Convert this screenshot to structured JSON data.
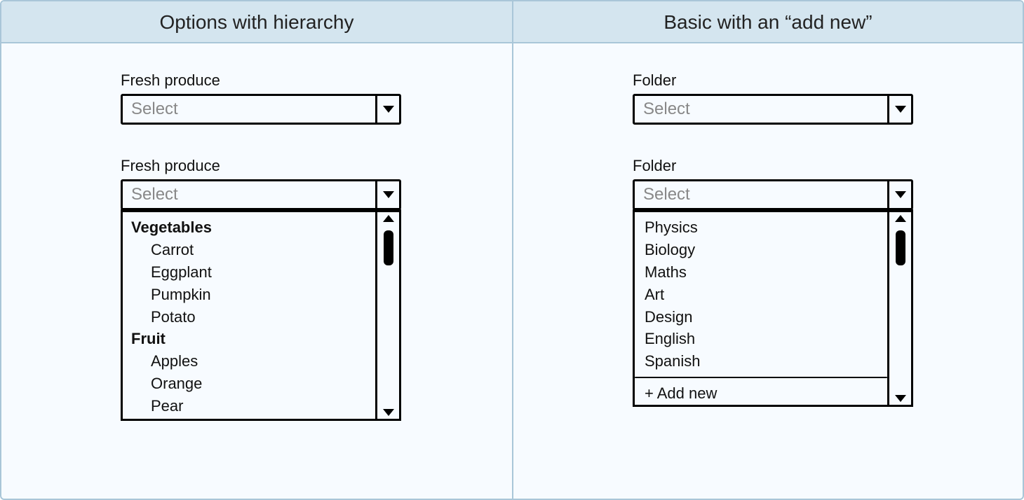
{
  "left": {
    "title": "Options with hierarchy",
    "field_label": "Fresh produce",
    "placeholder": "Select",
    "groups": [
      {
        "name": "Vegetables",
        "items": [
          "Carrot",
          "Eggplant",
          "Pumpkin",
          "Potato"
        ]
      },
      {
        "name": "Fruit",
        "items": [
          "Apples",
          "Orange",
          "Pear"
        ]
      }
    ]
  },
  "right": {
    "title": "Basic with an “add new”",
    "field_label": "Folder",
    "placeholder": "Select",
    "items": [
      "Physics",
      "Biology",
      "Maths",
      "Art",
      "Design",
      "English",
      "Spanish"
    ],
    "add_new_label": "+ Add new"
  }
}
